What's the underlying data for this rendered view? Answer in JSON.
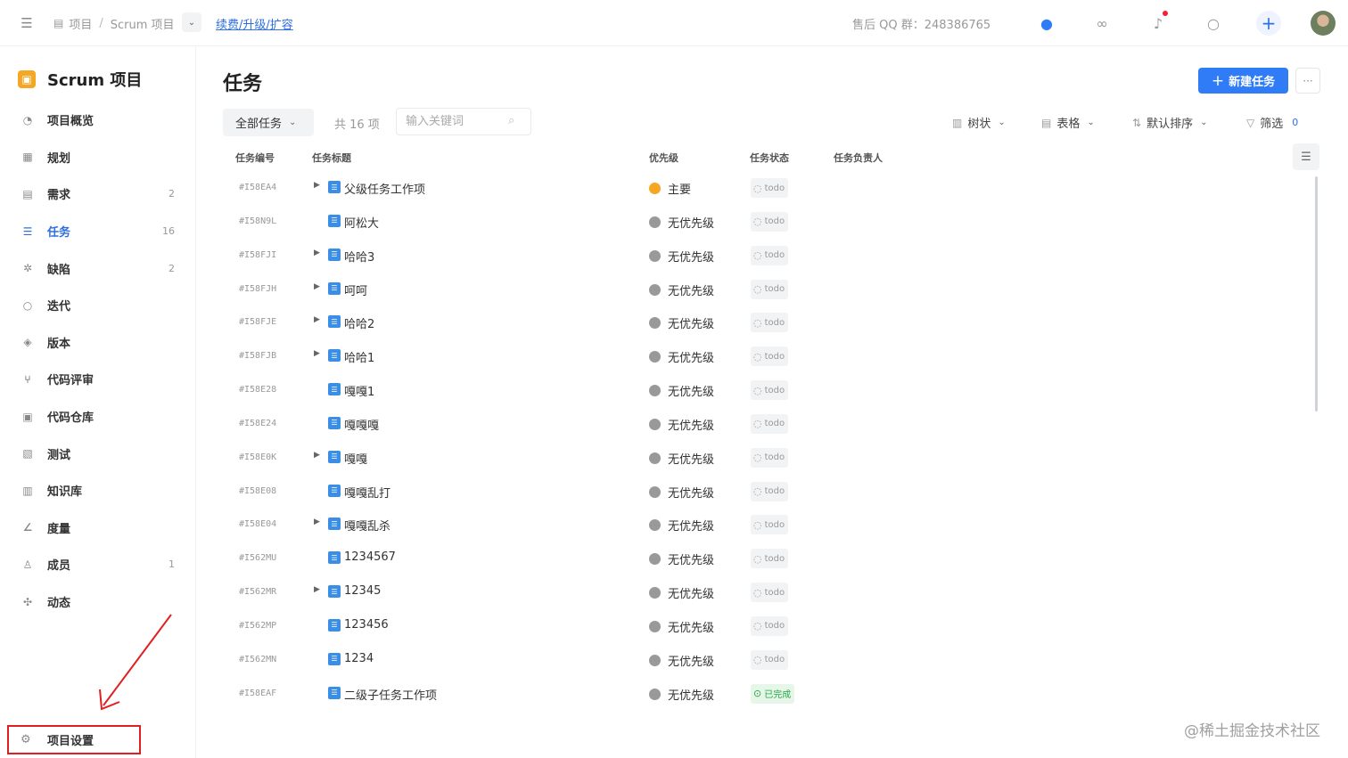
{
  "topbar": {
    "breadcrumb": {
      "root": "项目",
      "separator": "/",
      "current": "Scrum 项目"
    },
    "renew_link": "续费/升级/扩容",
    "qq_group": "售后 QQ 群：248386765"
  },
  "sidebar": {
    "project_name": "Scrum 项目",
    "items": [
      {
        "label": "项目概览",
        "icon": "dashboard-icon",
        "count": ""
      },
      {
        "label": "规划",
        "icon": "calendar-icon",
        "count": ""
      },
      {
        "label": "需求",
        "icon": "document-icon",
        "count": "2"
      },
      {
        "label": "任务",
        "icon": "task-icon",
        "count": "16",
        "active": true
      },
      {
        "label": "缺陷",
        "icon": "bug-icon",
        "count": "2"
      },
      {
        "label": "迭代",
        "icon": "cycle-icon",
        "count": ""
      },
      {
        "label": "版本",
        "icon": "layers-icon",
        "count": ""
      },
      {
        "label": "代码评审",
        "icon": "merge-icon",
        "count": ""
      },
      {
        "label": "代码仓库",
        "icon": "code-icon",
        "count": ""
      },
      {
        "label": "测试",
        "icon": "test-icon",
        "count": ""
      },
      {
        "label": "知识库",
        "icon": "book-icon",
        "count": ""
      },
      {
        "label": "度量",
        "icon": "chart-icon",
        "count": ""
      },
      {
        "label": "成员",
        "icon": "user-icon",
        "count": "1"
      },
      {
        "label": "动态",
        "icon": "activity-icon",
        "count": ""
      }
    ],
    "settings_label": "项目设置"
  },
  "main": {
    "title": "任务",
    "new_button": "新建任务",
    "filter": "全部任务",
    "count": "共 16 项",
    "search_placeholder": "输入关键词",
    "toolbar": {
      "tree": "树状",
      "table": "表格",
      "sort": "默认排序",
      "filter": "筛选",
      "filter_count": "0"
    },
    "columns": {
      "id": "任务编号",
      "title": "任务标题",
      "priority": "优先级",
      "status": "任务状态",
      "assignee": "任务负责人"
    },
    "rows": [
      {
        "id": "#I58EA4",
        "title": "父级任务工作项",
        "expandable": true,
        "priority": "主要",
        "major": true,
        "status": "todo"
      },
      {
        "id": "#I58N9L",
        "title": "阿松大",
        "expandable": false,
        "priority": "无优先级",
        "status": "todo"
      },
      {
        "id": "#I58FJI",
        "title": "哈哈3",
        "expandable": true,
        "priority": "无优先级",
        "status": "todo"
      },
      {
        "id": "#I58FJH",
        "title": "呵呵",
        "expandable": true,
        "priority": "无优先级",
        "status": "todo"
      },
      {
        "id": "#I58FJE",
        "title": "哈哈2",
        "expandable": true,
        "priority": "无优先级",
        "status": "todo"
      },
      {
        "id": "#I58FJB",
        "title": "哈哈1",
        "expandable": true,
        "priority": "无优先级",
        "status": "todo"
      },
      {
        "id": "#I58E28",
        "title": "嘎嘎1",
        "expandable": false,
        "priority": "无优先级",
        "status": "todo"
      },
      {
        "id": "#I58E24",
        "title": "嘎嘎嘎",
        "expandable": false,
        "priority": "无优先级",
        "status": "todo"
      },
      {
        "id": "#I58E0K",
        "title": "嘎嘎",
        "expandable": true,
        "priority": "无优先级",
        "status": "todo"
      },
      {
        "id": "#I58E08",
        "title": "嘎嘎乱打",
        "expandable": false,
        "priority": "无优先级",
        "status": "todo"
      },
      {
        "id": "#I58E04",
        "title": "嘎嘎乱杀",
        "expandable": true,
        "priority": "无优先级",
        "status": "todo"
      },
      {
        "id": "#I562MU",
        "title": "1234567",
        "expandable": false,
        "priority": "无优先级",
        "status": "todo"
      },
      {
        "id": "#I562MR",
        "title": "12345",
        "expandable": true,
        "priority": "无优先级",
        "status": "todo"
      },
      {
        "id": "#I562MP",
        "title": "123456",
        "expandable": false,
        "priority": "无优先级",
        "status": "todo"
      },
      {
        "id": "#I562MN",
        "title": "1234",
        "expandable": false,
        "priority": "无优先级",
        "status": "todo"
      },
      {
        "id": "#I58EAF",
        "title": "二级子任务工作项",
        "expandable": false,
        "priority": "无优先级",
        "status": "已完成",
        "done": true
      }
    ]
  },
  "watermark": "@稀土掘金技术社区",
  "colors": {
    "accent": "#2f7cf6",
    "major": "#f5a623",
    "done": "#28a745",
    "highlight_box": "#e02020"
  }
}
